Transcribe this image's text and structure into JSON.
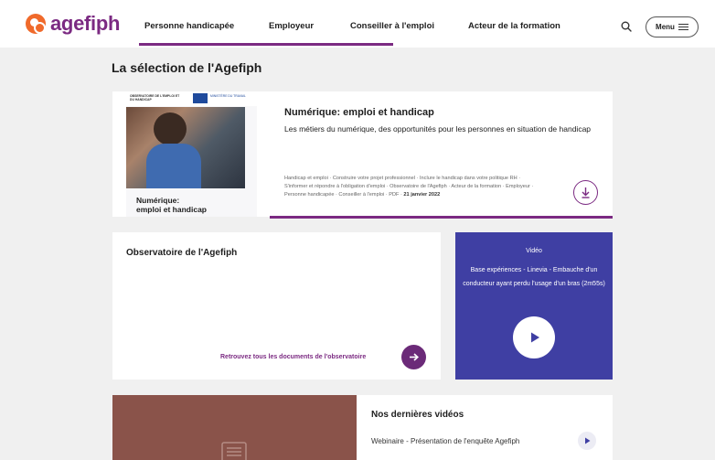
{
  "header": {
    "logo_text": "agefiph",
    "nav": [
      "Personne handicapée",
      "Employeur",
      "Conseiller à l'emploi",
      "Acteur de la formation"
    ],
    "menu_label": "Menu",
    "accent": "#7b2a82",
    "logo_color": "#f06a2b"
  },
  "section_title": "La sélection de l'Agefiph",
  "featured": {
    "cover": {
      "org": "OBSERVATOIRE DE L'EMPLOI ET DU HANDICAP",
      "ministry": "MINISTÈRE DU TRAVAIL",
      "title_line1": "Numérique:",
      "title_line2": "emploi et handicap"
    },
    "title": "Numérique: emploi et handicap",
    "description": "Les métiers du numérique, des opportunités pour les personnes en situation de handicap",
    "tags": "Handicap et emploi · Construire votre projet professionnel · Inclure le handicap dans votre politique RH · S'informer et répondre à l'obligation d'emploi · Observatoire de l'Agefiph · Acteur de la formation · Employeur · Personne handicapée · Conseiller à l'emploi · PDF ·",
    "date": "21 janvier 2022",
    "download_icon": "download-icon"
  },
  "observatoire": {
    "title": "Observatoire de l'Agefiph",
    "link": "Retrouvez tous les documents de l'observatoire",
    "icon": "arrow-right-icon"
  },
  "video": {
    "label": "Vidéo",
    "text": "Base expériences - Linevia - Embauche d'un conducteur ayant perdu l'usage d'un bras (2m55s)",
    "icon": "play-icon",
    "bg": "#3f3fa3"
  },
  "latest": {
    "title": "Nos dernières vidéos",
    "item": "Webinaire - Présentation de l'enquête Agefiph"
  }
}
